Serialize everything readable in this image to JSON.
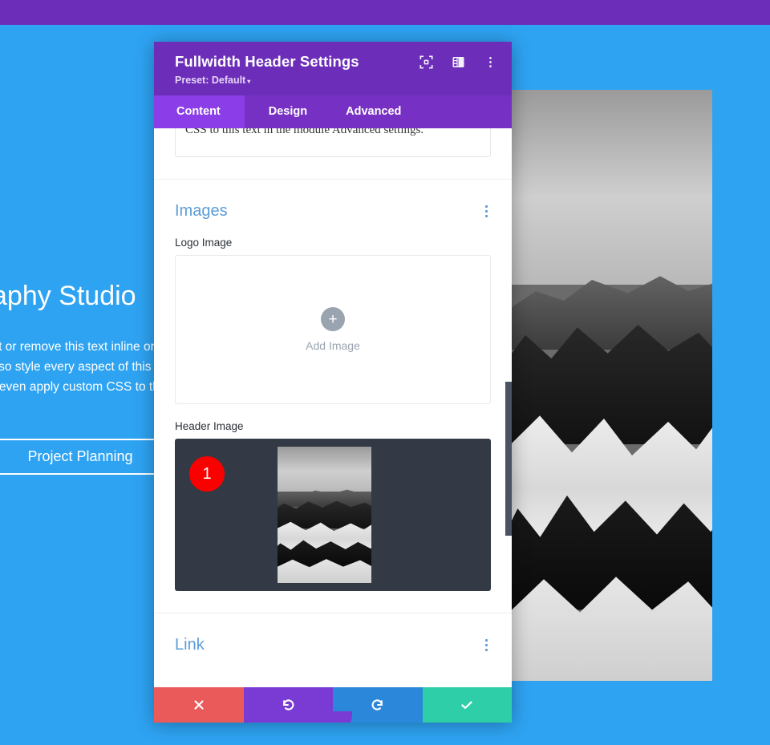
{
  "background": {
    "admin_bar_color": "#6c2eb9",
    "page_bg_color": "#2ea3f2",
    "hero": {
      "title": "aphy Studio",
      "body_lines": [
        "dit or remove this text inline or",
        "also style every aspect of this c",
        "d even apply custom CSS to th",
        "."
      ],
      "button_label": "Project Planning"
    }
  },
  "modal": {
    "title": "Fullwidth Header Settings",
    "preset_label": "Preset: Default",
    "preset_caret": "▾",
    "header_icons": [
      {
        "name": "fullscreen-icon"
      },
      {
        "name": "layout-panel-icon"
      },
      {
        "name": "kebab-menu-icon"
      }
    ],
    "tabs": [
      {
        "label": "Content",
        "active": true
      },
      {
        "label": "Design",
        "active": false
      },
      {
        "label": "Advanced",
        "active": false
      }
    ],
    "truncated_textarea_text": "CSS to this text in the module Advanced settings.",
    "sections": [
      {
        "title": "Images",
        "fields": [
          {
            "label": "Logo Image",
            "type": "dropzone",
            "add_label": "Add Image",
            "add_icon": "plus-icon"
          },
          {
            "label": "Header Image",
            "type": "image-preview",
            "badge": "1",
            "badge_color": "#fa0000",
            "preview_bg": "#333a45"
          }
        ]
      },
      {
        "title": "Link",
        "fields": []
      }
    ],
    "footer_buttons": [
      {
        "name": "cancel-button",
        "icon": "close-icon",
        "glyph": "✖",
        "color": "#ea5a5a"
      },
      {
        "name": "undo-button",
        "icon": "undo-icon",
        "glyph": "⟲",
        "color": "#7a3bd4"
      },
      {
        "name": "redo-button",
        "icon": "redo-icon",
        "glyph": "⟳",
        "color": "#2b87da"
      },
      {
        "name": "save-button",
        "icon": "check-icon",
        "glyph": "✔",
        "color": "#2ecfa8"
      }
    ]
  },
  "colors": {
    "modal_header": "#6c2eb9",
    "tab_bar": "#7730c4",
    "tab_active": "#8b3ee8",
    "section_title": "#5b9dd9",
    "scrollbar": "#4a5263"
  }
}
